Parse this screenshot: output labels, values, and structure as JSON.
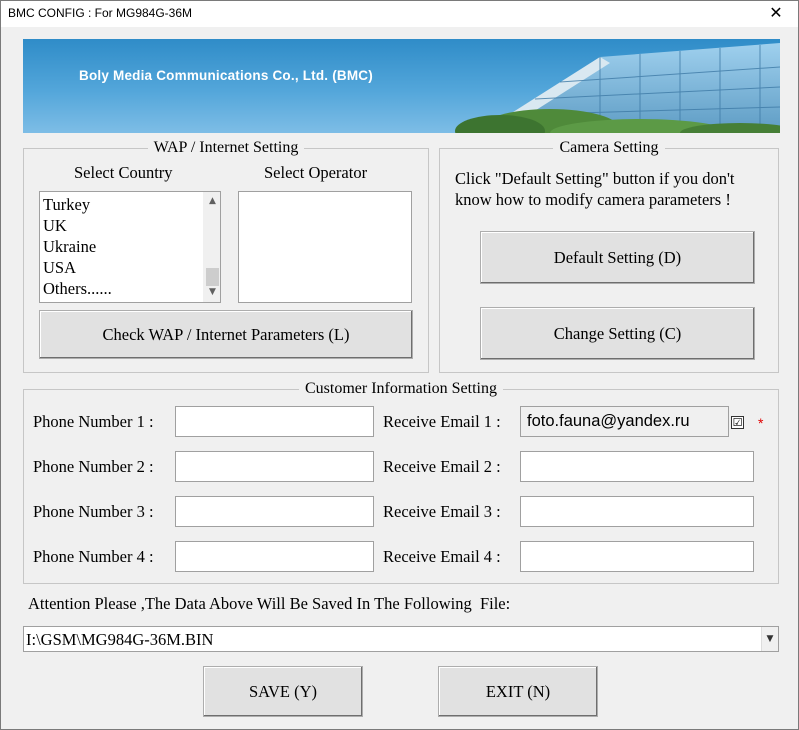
{
  "window": {
    "title": "BMC CONFIG : For MG984G-36M",
    "close_glyph": "✕"
  },
  "banner": {
    "company": "Boly Media Communications Co., Ltd. (BMC)"
  },
  "wap": {
    "legend": "WAP / Internet Setting",
    "country_label": "Select Country",
    "operator_label": "Select Operator",
    "countries": [
      "Turkey",
      "UK",
      "Ukraine",
      "USA",
      "Others......"
    ],
    "operators": [],
    "check_button": "Check WAP / Internet Parameters (L)"
  },
  "camera": {
    "legend": "Camera Setting",
    "hint_line1": "Click \"Default Setting\" button if you don't",
    "hint_line2": "know how to modify camera parameters !",
    "default_button": "Default Setting (D)",
    "change_button": "Change Setting (C)"
  },
  "customer": {
    "legend": "Customer Information Setting",
    "phones": [
      {
        "label": "Phone Number 1 :",
        "value": ""
      },
      {
        "label": "Phone Number 2 :",
        "value": ""
      },
      {
        "label": "Phone Number 3 :",
        "value": ""
      },
      {
        "label": "Phone Number 4 :",
        "value": ""
      }
    ],
    "emails": [
      {
        "label": "Receive Email 1 :",
        "value": "foto.fauna@yandex.ru"
      },
      {
        "label": "Receive Email 2 :",
        "value": ""
      },
      {
        "label": "Receive Email 3 :",
        "value": ""
      },
      {
        "label": "Receive Email 4 :",
        "value": ""
      }
    ],
    "email1_checked_glyph": "☑",
    "required_mark": "*"
  },
  "save_notice": "Attention Please ,The Data Above Will Be Saved In The Following  File:",
  "file_path": "I:\\GSM\\MG984G-36M.BIN",
  "buttons": {
    "save": "SAVE (Y)",
    "exit": "EXIT (N)"
  },
  "icons": {
    "scroll_up": "▲",
    "scroll_down": "▼",
    "combo_drop": "▼"
  }
}
